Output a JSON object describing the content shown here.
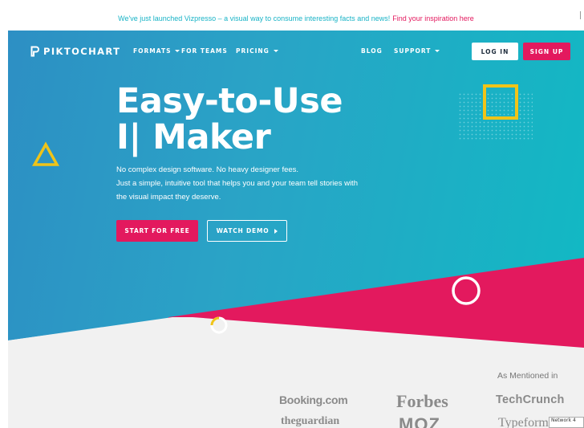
{
  "announcement": {
    "message": "We've just launched Vizpresso – a visual way to consume interesting facts and news!",
    "link_text": "Find your inspiration here"
  },
  "brand": {
    "name": "PIKTOCHART"
  },
  "nav": {
    "formats": "FORMATS",
    "for_teams": "FOR TEAMS",
    "pricing": "PRICING",
    "blog": "BLOG",
    "support": "SUPPORT",
    "login": "LOG IN",
    "signup": "SIGN UP"
  },
  "hero": {
    "headline_line1": "Easy-to-Use",
    "headline_line2": "I| Maker",
    "sub_line1": "No complex design software. No heavy designer fees.",
    "sub_line2": "Just a simple, intuitive tool that helps you and your team tell stories with",
    "sub_line3": "the visual impact they deserve.",
    "cta_start": "START FOR FREE",
    "cta_demo": "WATCH DEMO"
  },
  "mentioned": {
    "heading": "As Mentioned in",
    "logos": [
      "Booking.com",
      "Forbes",
      "TechCrunch",
      "theguardian",
      "MOZ",
      "Typeform"
    ]
  },
  "tooltip": {
    "text": "Network 4"
  },
  "colors": {
    "accent_pink": "#e3195e",
    "accent_teal": "#18b3c6",
    "accent_yellow": "#f0c419",
    "hero_blue": "#2d8fc4"
  },
  "icons": [
    "piktochart-logo-icon",
    "caret-down-icon",
    "play-arrow-icon",
    "triangle-icon",
    "square-icon",
    "circle-icon",
    "dot-grid-icon"
  ]
}
